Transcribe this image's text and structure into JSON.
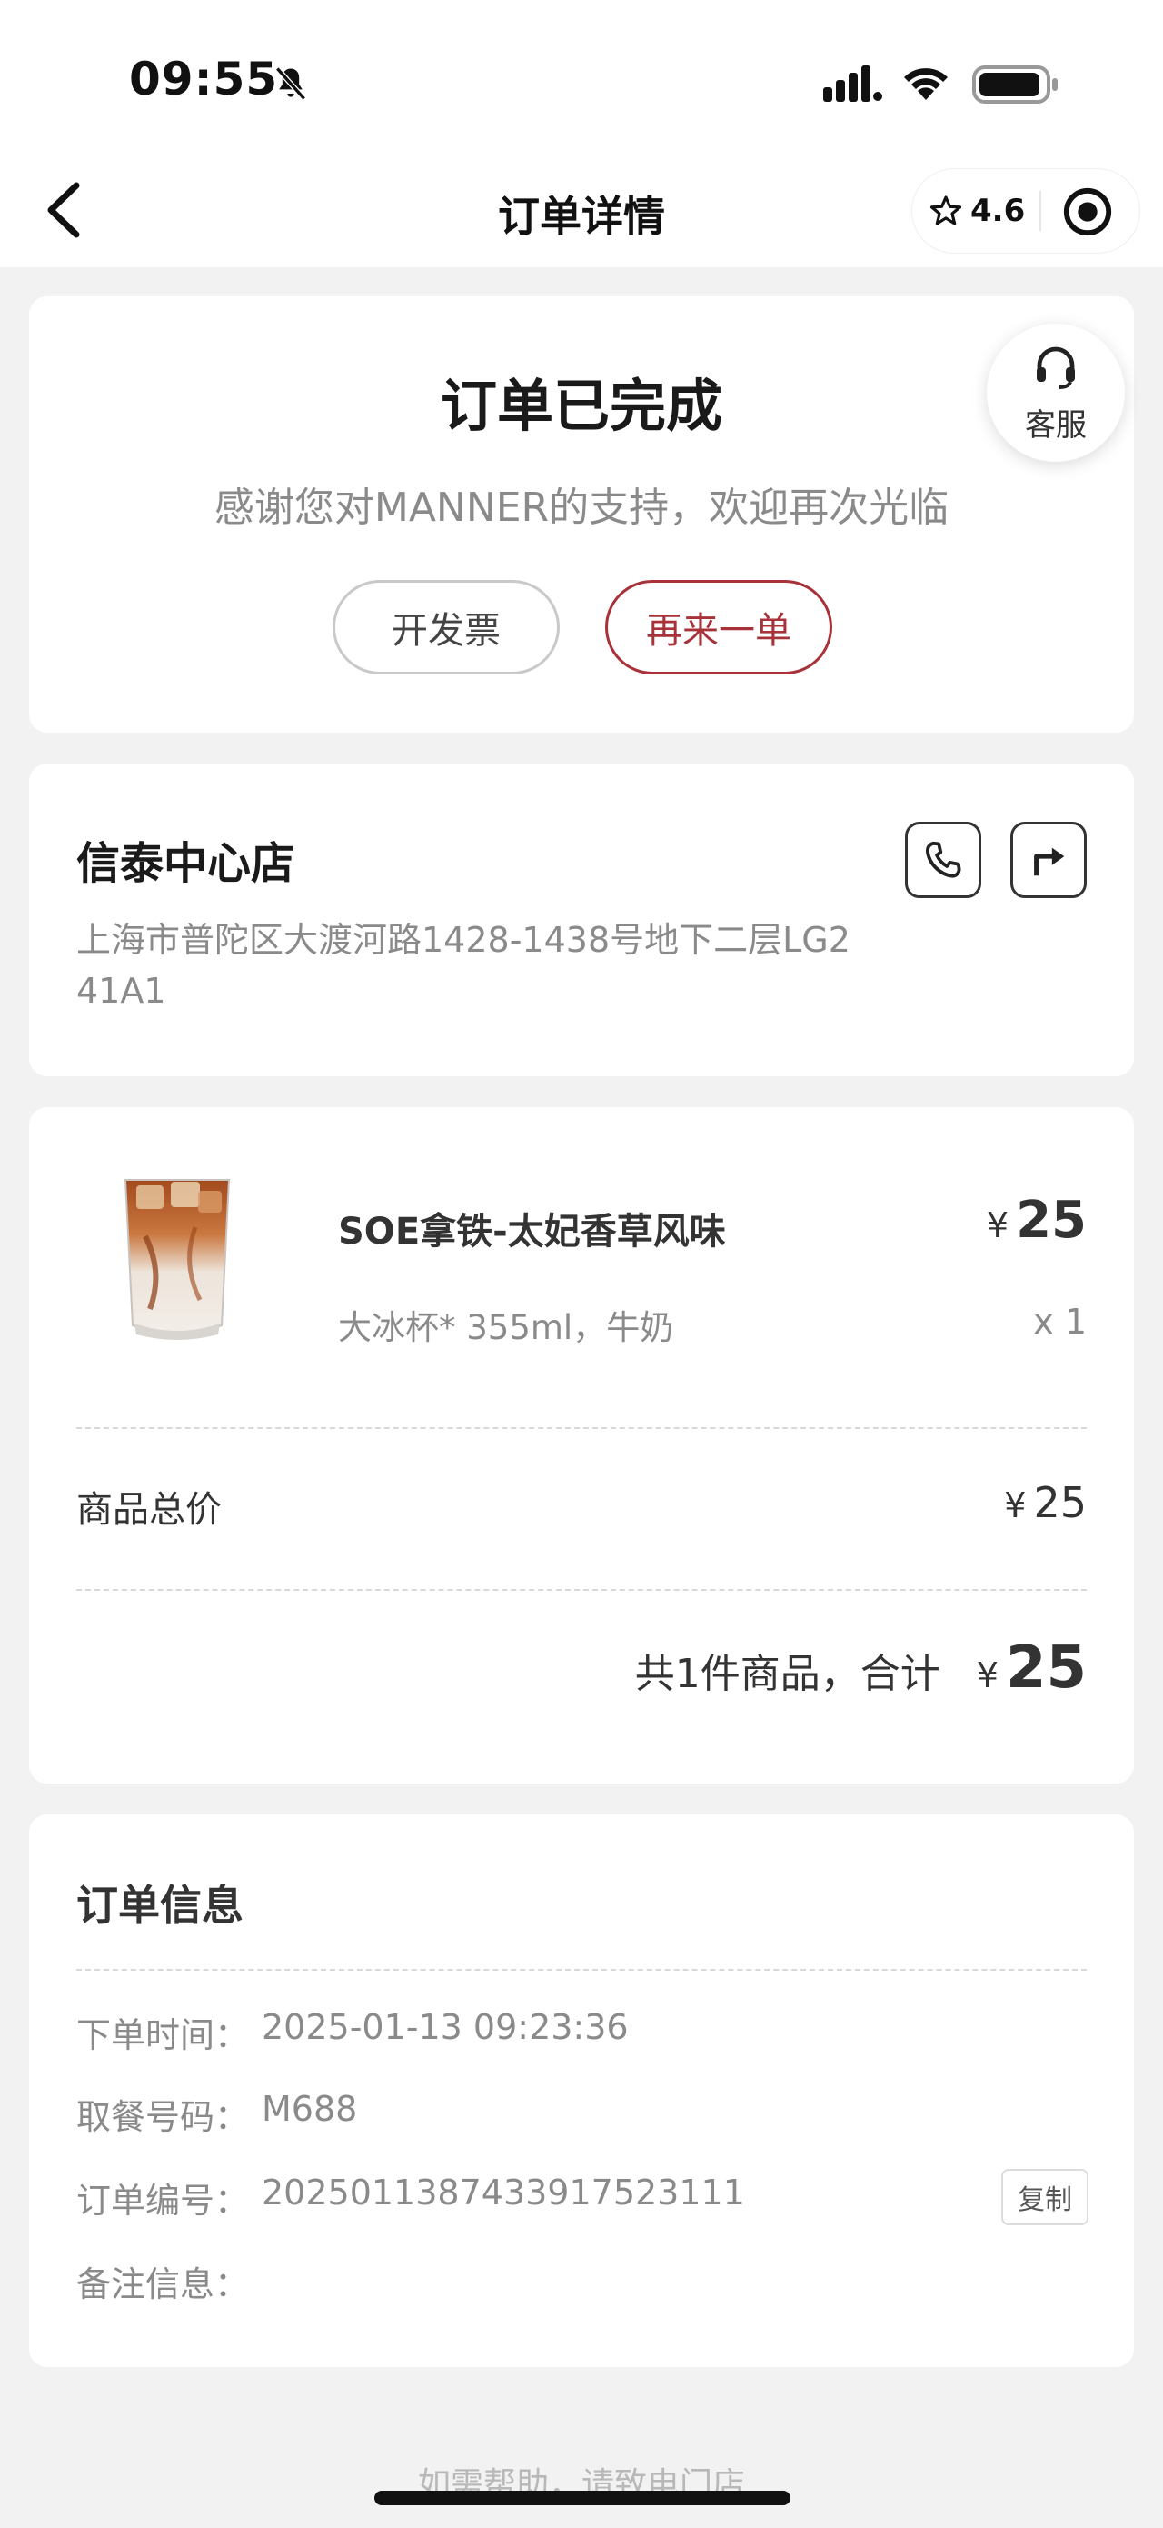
{
  "status_bar": {
    "time": "09:55",
    "icons": [
      "bell-muted-icon",
      "signal-icon",
      "wifi-icon",
      "battery-icon"
    ]
  },
  "nav": {
    "title": "订单详情",
    "rating": "4.6",
    "icons": [
      "chevron-left-icon",
      "star-icon",
      "target-icon"
    ]
  },
  "order_status": {
    "title": "订单已完成",
    "subtitle": "感谢您对MANNER的支持，欢迎再次光临",
    "invoice_button": "开发票",
    "reorder_button": "再来一单",
    "service_label": "客服",
    "accent_color": "#a8323a"
  },
  "store": {
    "name": "信泰中心店",
    "address": "上海市普陀区大渡河路1428-1438号地下二层LG2 41A1",
    "icons": [
      "phone-icon",
      "directions-icon"
    ]
  },
  "product": {
    "name": "SOE拿铁-太妃香草风味",
    "spec": "大冰杯* 355ml，牛奶",
    "currency": "¥",
    "price": "25",
    "qty": "x 1",
    "image": "iced-latte-glass-image"
  },
  "totals": {
    "subtotal_label": "商品总价",
    "subtotal_currency": "¥",
    "subtotal": "25",
    "grand_label": "共1件商品，合计",
    "grand_currency": "¥",
    "grand_total": "25"
  },
  "order_info": {
    "heading": "订单信息",
    "rows": [
      {
        "label": "下单时间：",
        "value": "2025-01-13 09:23:36"
      },
      {
        "label": "取餐号码：",
        "value": "M688"
      },
      {
        "label": "订单编号：",
        "value": "2025011387433917523111"
      },
      {
        "label": "备注信息：",
        "value": ""
      }
    ],
    "copy_button": "复制"
  },
  "footer": {
    "help_text": "如需帮助，请致电门店"
  }
}
